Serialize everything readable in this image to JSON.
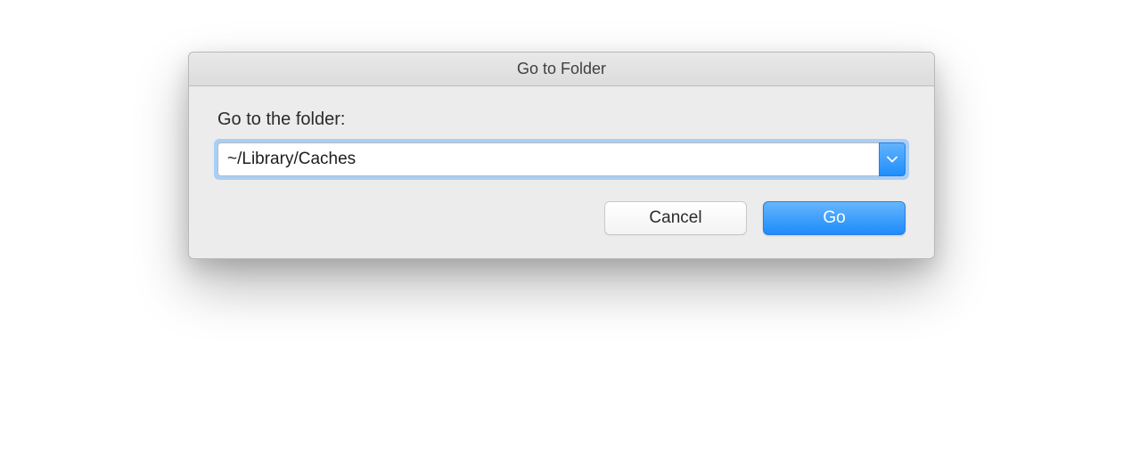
{
  "dialog": {
    "title": "Go to Folder",
    "label": "Go to the folder:",
    "path_value": "~/Library/Caches",
    "buttons": {
      "cancel": "Cancel",
      "go": "Go"
    }
  }
}
